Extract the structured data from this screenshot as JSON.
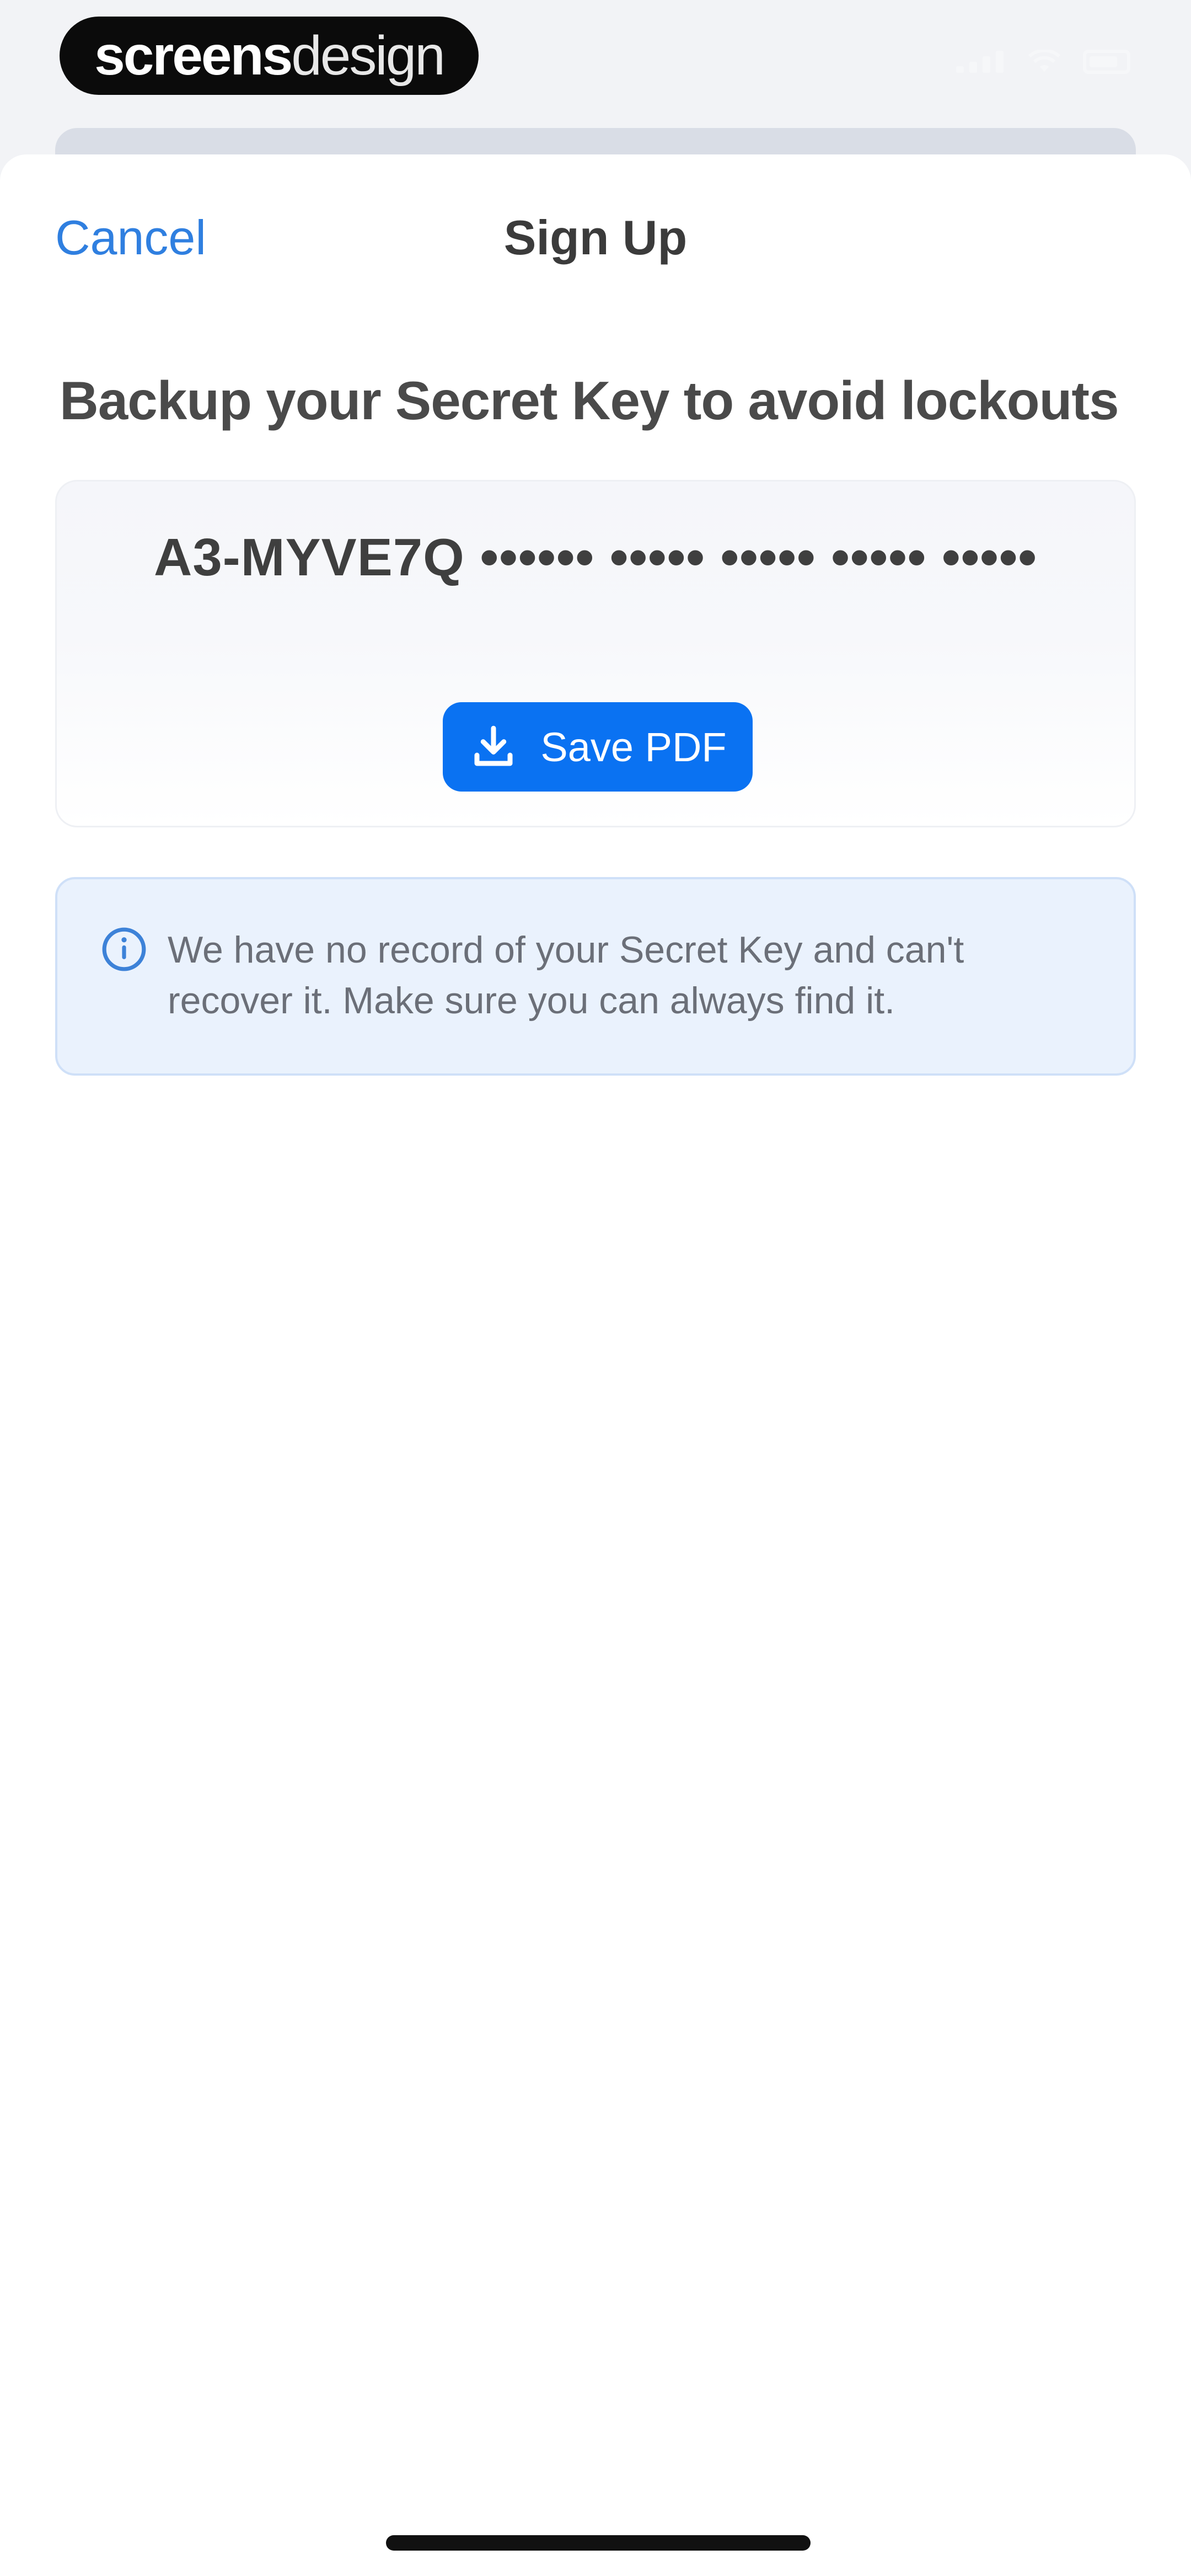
{
  "status_bar": {
    "brand_bold": "screens",
    "brand_light": "design"
  },
  "nav": {
    "cancel_label": "Cancel",
    "title": "Sign Up"
  },
  "headline": "Backup your Secret Key to avoid lockouts",
  "key_card": {
    "secret_key": "A3-MYVE7Q •••••• ••••• ••••• ••••• •••••",
    "save_label": "Save PDF"
  },
  "info": {
    "message": "We have no record of your Secret Key and can't recover it. Make sure you can always find it."
  },
  "colors": {
    "accent": "#0a72f2",
    "link": "#2f7fe0",
    "info_bg": "#eaf2fd"
  }
}
